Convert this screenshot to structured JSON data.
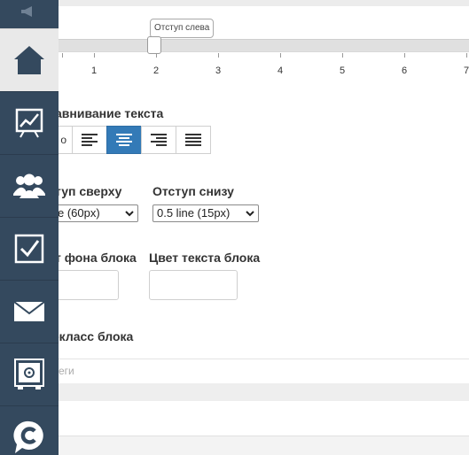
{
  "sidebar": {
    "items": [
      {
        "name": "home",
        "icon": "home-icon",
        "active": true
      },
      {
        "name": "stats",
        "icon": "chart-board-icon"
      },
      {
        "name": "users",
        "icon": "users-icon"
      },
      {
        "name": "tasks",
        "icon": "checkbox-icon"
      },
      {
        "name": "mail",
        "icon": "mail-icon"
      },
      {
        "name": "safe",
        "icon": "safe-icon"
      },
      {
        "name": "chat",
        "icon": "chat-c-icon"
      }
    ],
    "top_icon": "megaphone-icon"
  },
  "slider": {
    "tooltip": "Отступ слева",
    "value": 2,
    "tick_labels": [
      "1",
      "2",
      "3",
      "4",
      "5",
      "6",
      "7"
    ]
  },
  "alignment": {
    "label": "авнивание текста",
    "first_button_text": "о",
    "options": [
      "align-left",
      "align-center",
      "align-right",
      "align-justify"
    ],
    "selected": "align-center"
  },
  "padding_top": {
    "label": "туп сверху",
    "value": "e (60px)"
  },
  "padding_bottom": {
    "label": "Отступ снизу",
    "value": "0.5 line (15px)"
  },
  "bg_color": {
    "label": "т фона блока",
    "value": ""
  },
  "text_color": {
    "label": "Цвет текста блока",
    "value": ""
  },
  "css_class": {
    "label": "-класс блока",
    "placeholder": "еги"
  },
  "colors": {
    "sidebar": "#34495e",
    "active_button": "#337ab7"
  }
}
